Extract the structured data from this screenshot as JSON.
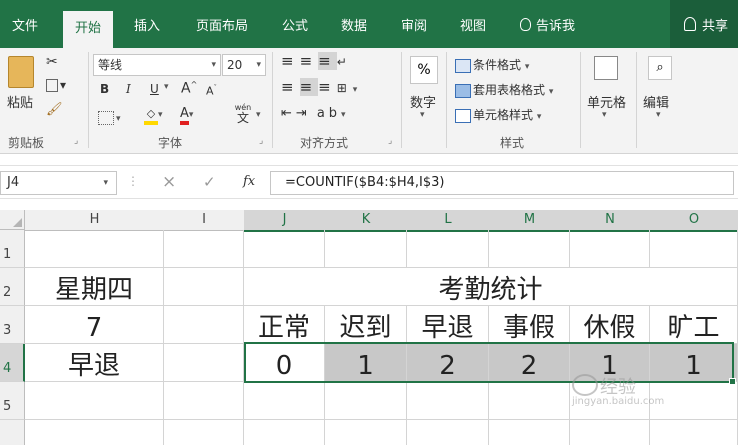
{
  "ribbon_tabs": [
    "文件",
    "开始",
    "插入",
    "页面布局",
    "公式",
    "数据",
    "审阅",
    "视图",
    "告诉我"
  ],
  "active_tab": "开始",
  "tell_me_icon": "lightbulb-icon",
  "share_label": "共享",
  "share_icon": "person-icon",
  "clipboard": {
    "paste": "粘贴",
    "group": "剪贴板",
    "icons": [
      "cut-icon",
      "copy-icon",
      "format-painter-icon"
    ]
  },
  "font": {
    "name": "等线",
    "size": "20",
    "bold": "B",
    "italic": "I",
    "underline": "U",
    "grow": "A",
    "shrink": "A",
    "font_color": "A",
    "phonetic": "wén",
    "phonetic_char": "文",
    "group": "字体",
    "icons": [
      "border-icon",
      "fill-color-icon",
      "font-color-icon"
    ]
  },
  "alignment": {
    "group": "对齐方式",
    "icons": [
      "align-top-icon",
      "align-middle-icon",
      "align-bottom-icon",
      "wrap-text-icon",
      "align-left-icon",
      "align-center-icon",
      "align-right-icon",
      "merge-icon",
      "indent-decrease-icon",
      "indent-increase-icon",
      "orientation-icon"
    ]
  },
  "number": {
    "symbol": "%",
    "label": "数字"
  },
  "styles": {
    "conditional": "条件格式",
    "table": "套用表格格式",
    "cell_style": "单元格样式",
    "group": "样式"
  },
  "cells": {
    "label": "单元格"
  },
  "editing": {
    "label": "编辑"
  },
  "formula_bar": {
    "name_box": "J4",
    "cancel": "×",
    "enter": "✓",
    "fx": "fx",
    "formula": "=COUNTIF($B4:$H4,I$3)"
  },
  "columns": [
    "H",
    "I",
    "J",
    "K",
    "L",
    "M",
    "N",
    "O"
  ],
  "rows": [
    "1",
    "2",
    "3",
    "4",
    "5"
  ],
  "selected_column_headers": [
    "J",
    "K",
    "L",
    "M",
    "N",
    "O"
  ],
  "selected_row": "4",
  "cells_data": {
    "h2": "星期四",
    "h3": "7",
    "h4": "早退",
    "summary_title": "考勤统计",
    "categories": [
      "正常",
      "迟到",
      "早退",
      "事假",
      "休假",
      "旷工"
    ],
    "counts": [
      "0",
      "1",
      "2",
      "2",
      "1",
      "1"
    ]
  },
  "watermark": {
    "text": "经验",
    "url": "jingyan.baidu.com"
  },
  "colors": {
    "accent": "#217346",
    "selection_fill": "#c8c8c8"
  }
}
